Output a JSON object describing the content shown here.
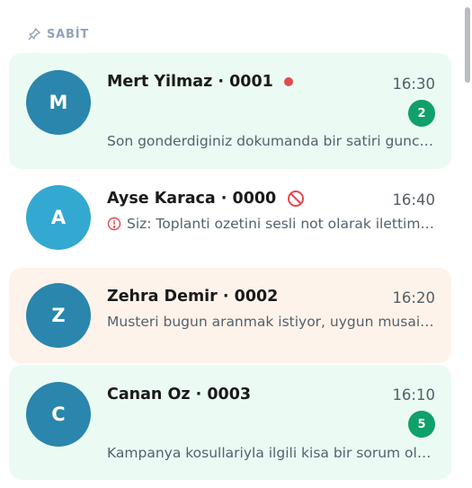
{
  "section": {
    "label": "SABİT",
    "icon": "pin-icon"
  },
  "colors": {
    "card_green": "#ebfbf3",
    "card_peach": "#fef3ea",
    "avatar_dark": "#2a86ad",
    "avatar_light": "#33a9d1",
    "badge": "#10a06a",
    "online_dot": "#e5484d",
    "warn": "#e5484d"
  },
  "chats": [
    {
      "initial": "M",
      "name": "Mert Yilmaz · 0001",
      "time": "16:30",
      "unread": "2",
      "preview": "Son gonderdiginiz dokumanda bir satiri guncellememiz gerekiyor",
      "status": "online-dot"
    },
    {
      "initial": "A",
      "name": "Ayse Karaca · 0000",
      "time": "16:40",
      "preview": "Siz: Toplanti ozetini sesli not olarak ilettim, dinleyebilirsiniz",
      "status": "blocked-icon",
      "preview_icon": "error-icon"
    },
    {
      "initial": "Z",
      "name": "Zehra Demir · 0002",
      "time": "16:20",
      "preview": "Musteri bugun aranmak istiyor, uygun musaitlik var mi?"
    },
    {
      "initial": "C",
      "name": "Canan Oz · 0003",
      "time": "16:10",
      "unread": "5",
      "preview": "Kampanya kosullariyla ilgili kisa bir sorum olacakti acaba"
    }
  ]
}
